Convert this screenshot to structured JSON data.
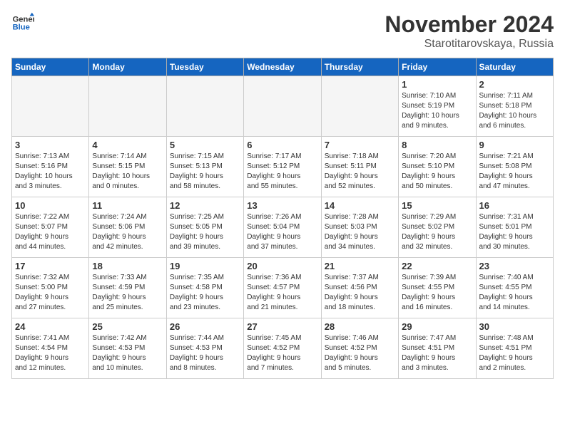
{
  "header": {
    "logo_line1": "General",
    "logo_line2": "Blue",
    "month_title": "November 2024",
    "location": "Starotitarovskaya, Russia"
  },
  "weekdays": [
    "Sunday",
    "Monday",
    "Tuesday",
    "Wednesday",
    "Thursday",
    "Friday",
    "Saturday"
  ],
  "weeks": [
    [
      {
        "day": "",
        "info": ""
      },
      {
        "day": "",
        "info": ""
      },
      {
        "day": "",
        "info": ""
      },
      {
        "day": "",
        "info": ""
      },
      {
        "day": "",
        "info": ""
      },
      {
        "day": "1",
        "info": "Sunrise: 7:10 AM\nSunset: 5:19 PM\nDaylight: 10 hours\nand 9 minutes."
      },
      {
        "day": "2",
        "info": "Sunrise: 7:11 AM\nSunset: 5:18 PM\nDaylight: 10 hours\nand 6 minutes."
      }
    ],
    [
      {
        "day": "3",
        "info": "Sunrise: 7:13 AM\nSunset: 5:16 PM\nDaylight: 10 hours\nand 3 minutes."
      },
      {
        "day": "4",
        "info": "Sunrise: 7:14 AM\nSunset: 5:15 PM\nDaylight: 10 hours\nand 0 minutes."
      },
      {
        "day": "5",
        "info": "Sunrise: 7:15 AM\nSunset: 5:13 PM\nDaylight: 9 hours\nand 58 minutes."
      },
      {
        "day": "6",
        "info": "Sunrise: 7:17 AM\nSunset: 5:12 PM\nDaylight: 9 hours\nand 55 minutes."
      },
      {
        "day": "7",
        "info": "Sunrise: 7:18 AM\nSunset: 5:11 PM\nDaylight: 9 hours\nand 52 minutes."
      },
      {
        "day": "8",
        "info": "Sunrise: 7:20 AM\nSunset: 5:10 PM\nDaylight: 9 hours\nand 50 minutes."
      },
      {
        "day": "9",
        "info": "Sunrise: 7:21 AM\nSunset: 5:08 PM\nDaylight: 9 hours\nand 47 minutes."
      }
    ],
    [
      {
        "day": "10",
        "info": "Sunrise: 7:22 AM\nSunset: 5:07 PM\nDaylight: 9 hours\nand 44 minutes."
      },
      {
        "day": "11",
        "info": "Sunrise: 7:24 AM\nSunset: 5:06 PM\nDaylight: 9 hours\nand 42 minutes."
      },
      {
        "day": "12",
        "info": "Sunrise: 7:25 AM\nSunset: 5:05 PM\nDaylight: 9 hours\nand 39 minutes."
      },
      {
        "day": "13",
        "info": "Sunrise: 7:26 AM\nSunset: 5:04 PM\nDaylight: 9 hours\nand 37 minutes."
      },
      {
        "day": "14",
        "info": "Sunrise: 7:28 AM\nSunset: 5:03 PM\nDaylight: 9 hours\nand 34 minutes."
      },
      {
        "day": "15",
        "info": "Sunrise: 7:29 AM\nSunset: 5:02 PM\nDaylight: 9 hours\nand 32 minutes."
      },
      {
        "day": "16",
        "info": "Sunrise: 7:31 AM\nSunset: 5:01 PM\nDaylight: 9 hours\nand 30 minutes."
      }
    ],
    [
      {
        "day": "17",
        "info": "Sunrise: 7:32 AM\nSunset: 5:00 PM\nDaylight: 9 hours\nand 27 minutes."
      },
      {
        "day": "18",
        "info": "Sunrise: 7:33 AM\nSunset: 4:59 PM\nDaylight: 9 hours\nand 25 minutes."
      },
      {
        "day": "19",
        "info": "Sunrise: 7:35 AM\nSunset: 4:58 PM\nDaylight: 9 hours\nand 23 minutes."
      },
      {
        "day": "20",
        "info": "Sunrise: 7:36 AM\nSunset: 4:57 PM\nDaylight: 9 hours\nand 21 minutes."
      },
      {
        "day": "21",
        "info": "Sunrise: 7:37 AM\nSunset: 4:56 PM\nDaylight: 9 hours\nand 18 minutes."
      },
      {
        "day": "22",
        "info": "Sunrise: 7:39 AM\nSunset: 4:55 PM\nDaylight: 9 hours\nand 16 minutes."
      },
      {
        "day": "23",
        "info": "Sunrise: 7:40 AM\nSunset: 4:55 PM\nDaylight: 9 hours\nand 14 minutes."
      }
    ],
    [
      {
        "day": "24",
        "info": "Sunrise: 7:41 AM\nSunset: 4:54 PM\nDaylight: 9 hours\nand 12 minutes."
      },
      {
        "day": "25",
        "info": "Sunrise: 7:42 AM\nSunset: 4:53 PM\nDaylight: 9 hours\nand 10 minutes."
      },
      {
        "day": "26",
        "info": "Sunrise: 7:44 AM\nSunset: 4:53 PM\nDaylight: 9 hours\nand 8 minutes."
      },
      {
        "day": "27",
        "info": "Sunrise: 7:45 AM\nSunset: 4:52 PM\nDaylight: 9 hours\nand 7 minutes."
      },
      {
        "day": "28",
        "info": "Sunrise: 7:46 AM\nSunset: 4:52 PM\nDaylight: 9 hours\nand 5 minutes."
      },
      {
        "day": "29",
        "info": "Sunrise: 7:47 AM\nSunset: 4:51 PM\nDaylight: 9 hours\nand 3 minutes."
      },
      {
        "day": "30",
        "info": "Sunrise: 7:48 AM\nSunset: 4:51 PM\nDaylight: 9 hours\nand 2 minutes."
      }
    ]
  ]
}
